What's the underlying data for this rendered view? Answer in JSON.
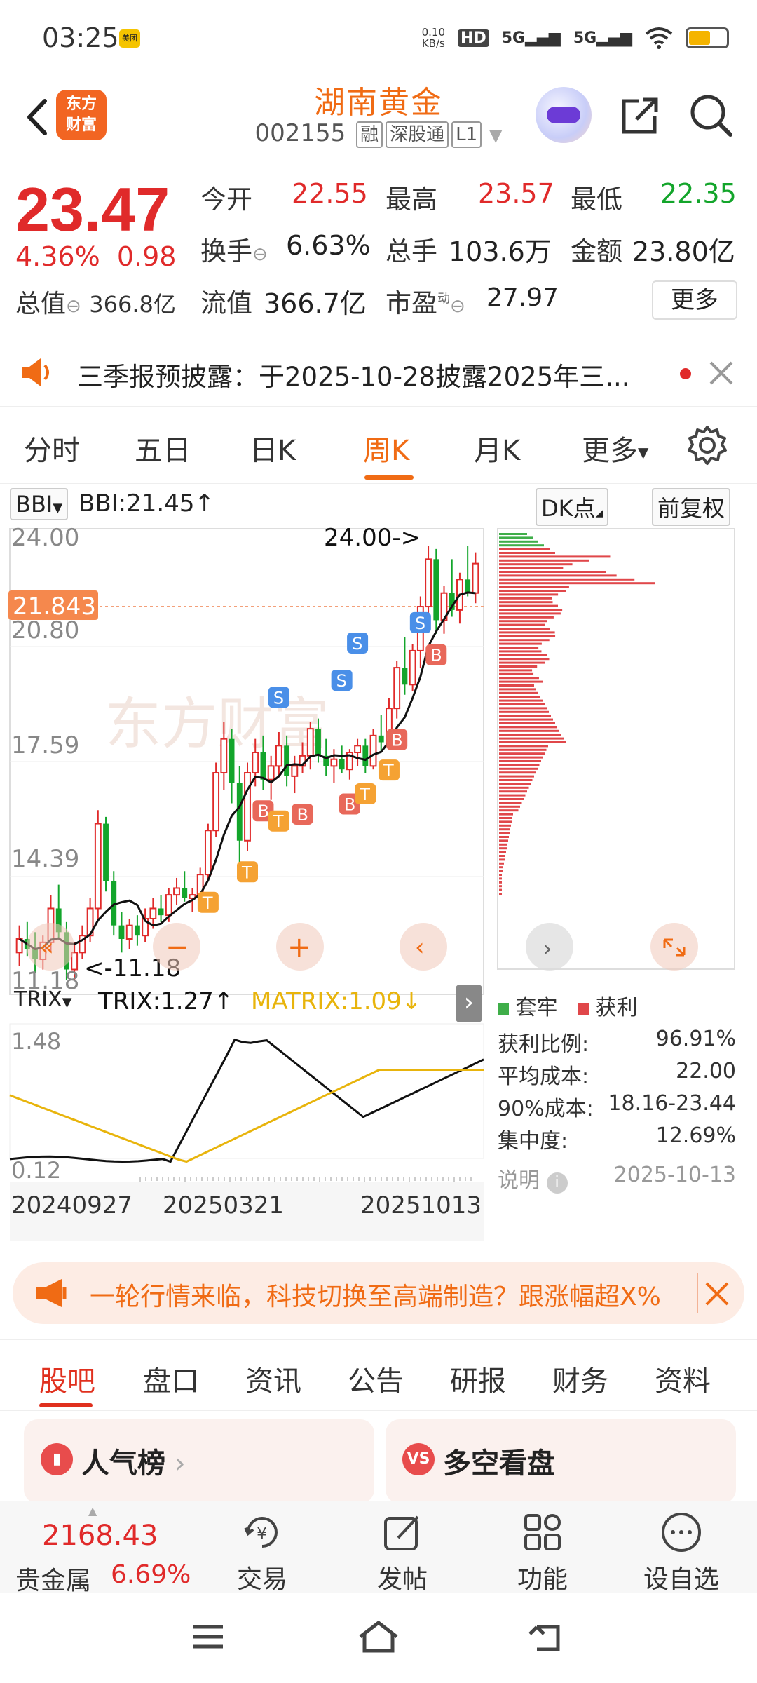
{
  "status_bar": {
    "time": "03:25",
    "app_badge": "美团",
    "net_speed_top": "0.10",
    "net_speed_bottom": "KB/s",
    "hd": "HD",
    "sig1": "5G",
    "sig2": "5G"
  },
  "header": {
    "logo_line1": "东方",
    "logo_line2": "财富",
    "stock_name": "湖南黄金",
    "stock_code": "002155",
    "tags": [
      "融",
      "深股通",
      "L1"
    ]
  },
  "quote": {
    "price": "23.47",
    "change_pct": "4.36%",
    "change_abs": "0.98",
    "open_label": "今开",
    "open": "22.55",
    "high_label": "最高",
    "high": "23.57",
    "low_label": "最低",
    "low": "22.35",
    "turnover_label": "换手",
    "turnover": "6.63%",
    "volume_label": "总手",
    "volume": "103.6万",
    "amount_label": "金额",
    "amount": "23.80亿",
    "mktcap_label": "总值",
    "mktcap": "366.8亿",
    "float_label": "流值",
    "float_cap": "366.7亿",
    "pe_label": "市盈",
    "pe_sup": "动",
    "pe": "27.97",
    "more": "更多"
  },
  "notice": {
    "text": "三季报预披露：于2025-10-28披露2025年三..."
  },
  "chart_tabs": [
    "分时",
    "五日",
    "日K",
    "周K",
    "月K",
    "更多"
  ],
  "indicator": {
    "bbi_btn": "BBI",
    "bbi_text": "BBI:21.45↑",
    "dk_btn": "DK点",
    "adj_btn": "前复权"
  },
  "price_axis": [
    "24.00",
    "20.80",
    "17.59",
    "14.39",
    "11.18"
  ],
  "current_line_label": "21.843",
  "max_annot": "24.00->",
  "min_annot": "<-11.18",
  "trix": {
    "btn": "TRIX",
    "trix_text": "TRIX:1.27↑",
    "matrix_text": "MATRIX:1.09↓",
    "axis_top": "1.48",
    "axis_bottom": "0.12"
  },
  "dates": [
    "20240927",
    "20250321",
    "20251013"
  ],
  "chip": {
    "legend_locked": "套牢",
    "legend_profit": "获利",
    "rows": [
      {
        "label": "获利比例:",
        "value": "96.91%"
      },
      {
        "label": "平均成本:",
        "value": "22.00"
      },
      {
        "label": "90%成本:",
        "value": "18.16-23.44"
      },
      {
        "label": "集中度:",
        "value": "12.69%"
      }
    ],
    "note": "说明",
    "date": "2025-10-13"
  },
  "ticker": {
    "text": "一轮行情来临，科技切换至高端制造？跟涨幅超X%"
  },
  "bottom_tabs": [
    "股吧",
    "盘口",
    "资讯",
    "公告",
    "研报",
    "财务",
    "资料"
  ],
  "cards": [
    {
      "title": "人气榜"
    },
    {
      "title": "多空看盘"
    }
  ],
  "toolbar": {
    "index_value": "2168.43",
    "index_name": "贵金属",
    "index_pct": "6.69%",
    "items": [
      "交易",
      "发帖",
      "功能",
      "设自选"
    ]
  },
  "colors": {
    "accent": "#f06b14",
    "up": "#e02a2a",
    "down": "#13a52b",
    "bbi_line": "#111111",
    "matrix_line": "#e8b40c"
  },
  "chart_data": {
    "type": "candlestick",
    "period": "weekly",
    "ylim": [
      11.18,
      24.0
    ],
    "candles": [
      [
        12.0,
        12.8,
        11.6,
        12.4
      ],
      [
        12.4,
        12.9,
        11.9,
        12.1
      ],
      [
        12.1,
        12.6,
        11.4,
        11.8
      ],
      [
        11.8,
        12.5,
        11.5,
        12.3
      ],
      [
        12.3,
        13.7,
        12.0,
        13.3
      ],
      [
        13.3,
        14.0,
        12.4,
        12.6
      ],
      [
        12.6,
        12.9,
        11.2,
        11.5
      ],
      [
        11.5,
        12.3,
        11.18,
        12.0
      ],
      [
        12.0,
        12.8,
        11.8,
        12.5
      ],
      [
        12.5,
        13.6,
        12.3,
        13.3
      ],
      [
        13.3,
        16.2,
        13.0,
        15.8
      ],
      [
        15.8,
        16.0,
        13.8,
        14.1
      ],
      [
        14.1,
        14.4,
        12.5,
        12.8
      ],
      [
        12.8,
        13.2,
        12.0,
        12.4
      ],
      [
        12.4,
        13.0,
        12.1,
        12.8
      ],
      [
        12.8,
        13.1,
        12.2,
        12.5
      ],
      [
        12.5,
        13.3,
        12.3,
        13.0
      ],
      [
        13.0,
        13.6,
        12.7,
        13.3
      ],
      [
        13.3,
        13.7,
        12.9,
        13.1
      ],
      [
        13.1,
        13.9,
        12.9,
        13.7
      ],
      [
        13.7,
        14.2,
        13.4,
        13.9
      ],
      [
        13.9,
        14.4,
        13.5,
        13.6
      ],
      [
        13.6,
        13.9,
        13.2,
        13.7
      ],
      [
        13.7,
        14.5,
        13.5,
        14.3
      ],
      [
        14.3,
        15.8,
        14.1,
        15.6
      ],
      [
        15.6,
        17.6,
        15.4,
        17.3
      ],
      [
        17.3,
        18.8,
        16.8,
        18.3
      ],
      [
        18.3,
        18.6,
        16.4,
        17.0
      ],
      [
        17.0,
        17.5,
        14.6,
        15.3
      ],
      [
        15.3,
        17.6,
        15.0,
        17.3
      ],
      [
        17.3,
        18.3,
        16.9,
        17.9
      ],
      [
        17.9,
        18.4,
        16.8,
        17.1
      ],
      [
        17.1,
        17.8,
        16.5,
        17.5
      ],
      [
        17.5,
        18.5,
        17.2,
        18.1
      ],
      [
        18.1,
        18.4,
        16.9,
        17.2
      ],
      [
        17.2,
        17.8,
        16.7,
        17.5
      ],
      [
        17.5,
        18.2,
        17.3,
        17.8
      ],
      [
        17.8,
        18.8,
        17.4,
        18.6
      ],
      [
        18.6,
        18.9,
        17.6,
        17.8
      ],
      [
        17.8,
        18.3,
        17.2,
        17.5
      ],
      [
        17.5,
        18.0,
        17.0,
        17.7
      ],
      [
        17.7,
        18.1,
        17.3,
        17.4
      ],
      [
        17.4,
        18.0,
        17.1,
        17.9
      ],
      [
        17.9,
        18.3,
        17.5,
        18.1
      ],
      [
        18.1,
        18.3,
        17.3,
        17.5
      ],
      [
        17.5,
        18.6,
        17.4,
        18.4
      ],
      [
        18.4,
        19.0,
        17.9,
        18.2
      ],
      [
        18.2,
        19.5,
        18.0,
        19.2
      ],
      [
        19.2,
        20.6,
        18.9,
        20.4
      ],
      [
        20.4,
        21.3,
        19.6,
        19.9
      ],
      [
        19.9,
        21.1,
        19.7,
        20.9
      ],
      [
        20.9,
        22.5,
        20.4,
        22.2
      ],
      [
        22.2,
        24.0,
        21.8,
        23.6
      ],
      [
        23.6,
        23.9,
        21.4,
        21.8
      ],
      [
        21.8,
        22.8,
        21.4,
        22.6
      ],
      [
        22.6,
        23.6,
        21.9,
        22.1
      ],
      [
        22.1,
        23.2,
        21.7,
        23.0
      ],
      [
        23.0,
        24.0,
        22.5,
        22.6
      ],
      [
        22.6,
        23.8,
        22.3,
        23.47
      ]
    ],
    "trix_ylim": [
      0.12,
      1.48
    ]
  }
}
